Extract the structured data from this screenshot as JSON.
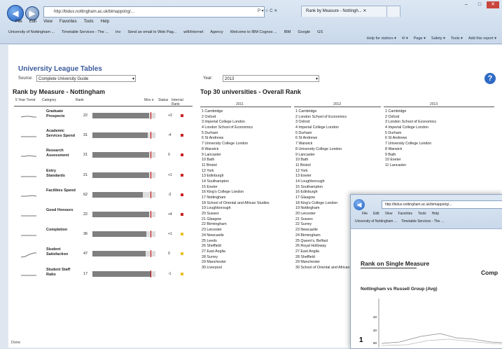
{
  "browser": {
    "url": "http://bidus.nottingham.ac.uk/bimappstrg/...",
    "addr_tools": "P ▾ ☆ C ✕",
    "tabs": [
      "Rank by Measure - Nottingh... ✕"
    ],
    "menu": [
      "File",
      "Edit",
      "View",
      "Favorites",
      "Tools",
      "Help"
    ],
    "favorites": [
      "University of Nottingham ...",
      "Timetable Services - The ...",
      "Inv",
      "Send an email to Web Pag...",
      "wifi/Internet",
      "Agency",
      "Welcome to IBM Cognos ...",
      "IBM",
      "Google",
      "GS"
    ],
    "toolbar": [
      "Help for visitors ▾",
      "✉ ▾",
      "Page ▾",
      "Safety ▾",
      "Tools ▾",
      "Add this report ▾"
    ],
    "status": "Done"
  },
  "report": {
    "title": "University League Tables",
    "source_label": "Source:",
    "source_value": "Complete University Guide",
    "year_label": "Year:",
    "year_value": "2013",
    "left_heading": "Rank by Measure  - Nottingham",
    "right_heading": "Top 30 universities - Overall Rank",
    "col_headers": {
      "trend": "5 Year Trend",
      "category": "Category",
      "rank": "Rank",
      "movement": "Mov e",
      "status": "Status",
      "internal": "Internal Rank"
    },
    "year_cols": [
      "2011",
      "2012",
      "2013"
    ]
  },
  "measures": [
    {
      "name": "Graduate Prospects",
      "rank": "22",
      "fill": 0.9,
      "movement": "+3",
      "status_color": "#cc2222"
    },
    {
      "name": "Academic Services Spend",
      "rank": "31",
      "fill": 0.88,
      "movement": "-4",
      "status_color": "#cc2222"
    },
    {
      "name": "Research Assessment",
      "rank": "21",
      "fill": 0.9,
      "movement": "0",
      "status_color": "#cc2222"
    },
    {
      "name": "Entry Standards",
      "rank": "21",
      "fill": 0.9,
      "movement": "+1",
      "status_color": "#cc2222"
    },
    {
      "name": "Facilities Spend",
      "rank": "62",
      "fill": 0.8,
      "movement": "-2",
      "status_color": "#cc2222"
    },
    {
      "name": "Good Honours",
      "rank": "22",
      "fill": 0.9,
      "movement": "+4",
      "status_color": "#cc2222"
    },
    {
      "name": "Completion",
      "rank": "36",
      "fill": 0.86,
      "movement": "+1",
      "status_color": "#e8c020"
    },
    {
      "name": "Student Satisfaction",
      "rank": "47",
      "fill": 0.84,
      "movement": "0",
      "status_color": "#e8c020"
    },
    {
      "name": "Student Staff Ratio",
      "rank": "17",
      "fill": 0.92,
      "movement": "-1",
      "status_color": "#e8c020"
    }
  ],
  "rankings": {
    "y2011": [
      "1 Cambridge",
      "2 Oxford",
      "3 Imperial College London",
      "4 London School of Economics",
      "5 Durham",
      "6 St Andrews",
      "7 University College London",
      "8 Warwick",
      "9 Lancaster",
      "10 Bath",
      "11 Bristol",
      "12 York",
      "13 Edinburgh",
      "14 Southampton",
      "15 Exeter",
      "16 King's College London",
      "17 Nottingham",
      "18 School of Oriental and African Studies",
      "19 Loughborough",
      "20 Sussex",
      "21 Glasgow",
      "22 Birmingham",
      "23 Leicester",
      "24 Newcastle",
      "25 Leeds",
      "26 Sheffield",
      "27 East Anglia",
      "28 Surrey",
      "29 Manchester",
      "30 Liverpool"
    ],
    "y2012": [
      "1 Cambridge",
      "2 London School of Economics",
      "3 Oxford",
      "4 Imperial College London",
      "5 Durham",
      "6 St Andrews",
      "7 Warwick",
      "8 University College London",
      "9 Lancaster",
      "10 Bath",
      "11 Bristol",
      "12 York",
      "13 Exeter",
      "14 Loughborough",
      "15 Southampton",
      "16 Edinburgh",
      "17 Glasgow",
      "18 King's College London",
      "19 Nottingham",
      "20 Leicester",
      "21 Sussex",
      "22 Surrey",
      "23 Newcastle",
      "24 Birmingham",
      "25 Queen's, Belfast",
      "26 Royal Holloway",
      "27 East Anglia",
      "28 Sheffield",
      "29 Manchester",
      "30 School of Oriental and African Studies"
    ],
    "y2013": [
      "1 Cambridge",
      "2 Oxford",
      "3 London School of Economics",
      "4 Imperial College London",
      "5 Durham",
      "6 St Andrews",
      "7 University College London",
      "8 Warwick",
      "9 Bath",
      "10 Exeter",
      "11 Lancaster"
    ]
  },
  "popup": {
    "url": "http://bidus.nottingham.ac.uk/bimappstrg/...",
    "menu": [
      "File",
      "Edit",
      "View",
      "Favorites",
      "Tools",
      "Help"
    ],
    "favorites": [
      "University of Nottingham ...",
      "Timetable Services - The ..."
    ],
    "title": "Rank on Single Measure",
    "comp": "Comp",
    "subtitle": "Nottingham vs Russell Group (Avg)",
    "axis_labels": [
      "20",
      "40",
      "60"
    ],
    "big_tick": "1"
  }
}
